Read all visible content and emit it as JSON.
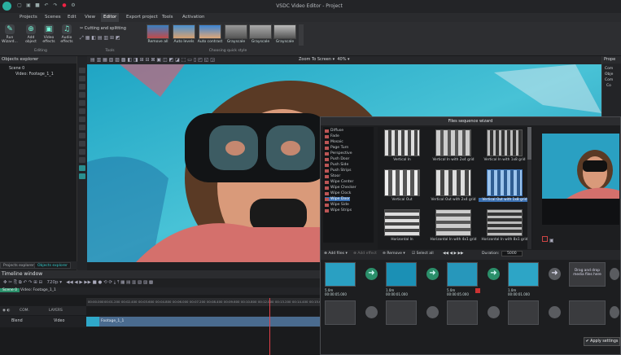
{
  "app": {
    "title": "VSDC Video Editor - Project"
  },
  "menu": [
    "Projects",
    "Scenes",
    "Edit",
    "View",
    "Editor",
    "Export project",
    "Tools",
    "Activation"
  ],
  "menu_active_index": 4,
  "ribbon": {
    "run_wizard": "Run Wizard...",
    "add_object": "Add object",
    "video_effects": "Video effects",
    "audio_effects": "Audio effects",
    "editing_label": "Editing",
    "cutting": "Cutting and splitting",
    "tools_label": "Tools",
    "quick_style_label": "Choosing quick style",
    "quick_styles": [
      "Remove all",
      "Auto levels",
      "Auto contrast",
      "Grayscale",
      "Grayscale",
      "Grayscale"
    ]
  },
  "left_panel": {
    "title": "Objects explorer",
    "tree": [
      "Scene 0",
      "Video: Footage_1_1"
    ],
    "tabs": [
      "Projects explorer",
      "Objects explorer"
    ]
  },
  "toolbar2": {
    "zoom": "Zoom To Screen",
    "zoom_pct": "40%"
  },
  "right_panel": {
    "title": "Prope",
    "items": [
      "Com",
      "Obje",
      "Com",
      "Co"
    ]
  },
  "timeline": {
    "title": "Timeline window",
    "zoom": "720p",
    "tabs": [
      "Scene 0",
      "Video: Footage_1_1"
    ],
    "layers_label": "LAYERS",
    "com_label": "COM.",
    "blend": "Blend",
    "track": "Video",
    "clip": "Footage_1_1",
    "ruler": [
      "00:00.000",
      "00:01.200",
      "00:02.400",
      "00:03.600",
      "00:04.800",
      "00:06.000",
      "00:07.200",
      "00:08.400",
      "00:09.600",
      "00:10.800",
      "00:12.000",
      "00:13.200",
      "00:14.400",
      "00:15.600"
    ]
  },
  "wizard": {
    "title": "Files sequence wizard",
    "effects": [
      "Diffuse",
      "Fade",
      "Mosaic",
      "Page Turn",
      "Perspective",
      "Push Door",
      "Push Side",
      "Push Strips",
      "Stoor",
      "Wipe Center",
      "Wipe Checker",
      "Wipe Clock",
      "Wipe Door",
      "Wipe Side",
      "Wipe Strips"
    ],
    "selected_effect_index": 12,
    "thumbs": [
      "Vertical In",
      "Vertical In with 2x4 grid",
      "Vertical In with 1x8 grid",
      "Vertical Out",
      "Vertical Out with 2x4 grid",
      "Vertical Out with 1x8 grid",
      "Horizontal In",
      "Horizontal In with 4x1 grid",
      "Horizontal In with 8x1 grid"
    ],
    "selected_thumb_index": 5,
    "toolbar": {
      "add": "Add files",
      "add_effect": "Add effect",
      "remove": "Remove",
      "select_all": "Select all",
      "duration_label": "Duration:",
      "duration": "5000"
    },
    "slots": [
      {
        "dur": "5.0m",
        "time": "00:00:05.000"
      },
      {
        "dur": "1.0m",
        "time": "00:00:01.000"
      },
      {
        "dur": "5.0m",
        "time": "00:00:05.000"
      },
      {
        "dur": "1.0m",
        "time": "00:00:01.000"
      },
      {
        "dur": "5.0m",
        "time": "00:00:05.000"
      }
    ],
    "drag_text": "Drag and drop media files here",
    "apply": "Apply settings"
  }
}
